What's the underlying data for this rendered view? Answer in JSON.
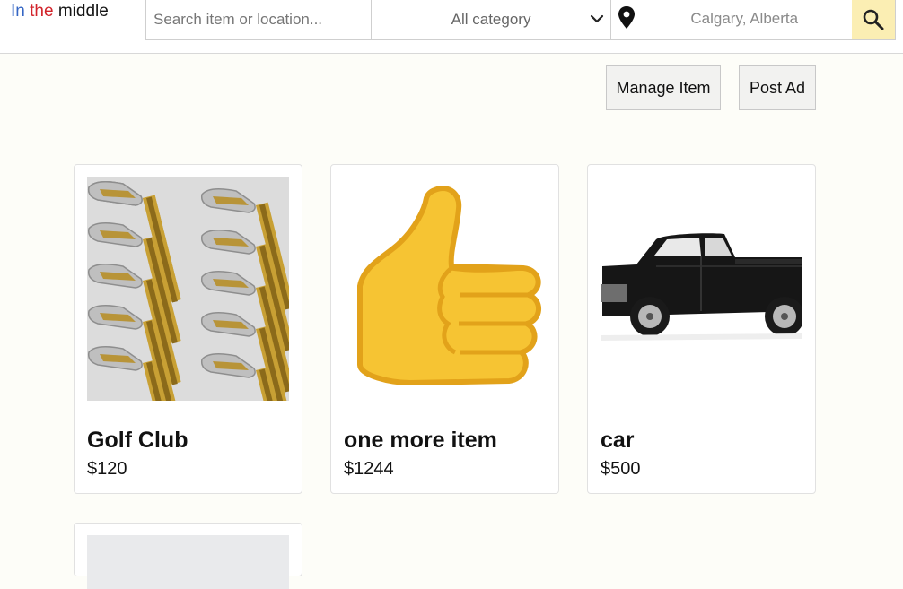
{
  "header": {
    "logo": {
      "word1": "In",
      "word2": "the",
      "word3": "middle"
    },
    "search": {
      "placeholder": "Search item or location..."
    },
    "category": {
      "selected": "All category",
      "icon": "chevron-down-icon"
    },
    "location": {
      "value": "Calgary, Alberta",
      "icon": "map-pin-icon"
    },
    "search_button": {
      "icon": "search-icon",
      "color": "#fbeeb3"
    }
  },
  "actions": {
    "manage_label": "Manage Item",
    "post_label": "Post Ad"
  },
  "listings": [
    {
      "title": "Golf Club",
      "price": "$120",
      "image": "golf-clubs-photo"
    },
    {
      "title": "one more item",
      "price": "$1244",
      "image": "thumbs-up-emoji"
    },
    {
      "title": "car",
      "price": "$500",
      "image": "black-pickup-truck-photo"
    },
    {
      "title": "",
      "price": "",
      "image": "placeholder-image"
    }
  ],
  "colors": {
    "logo_blue": "#3566c4",
    "logo_red": "#d2242b",
    "accent": "#fbeeb3",
    "background": "#fdfdf8"
  }
}
